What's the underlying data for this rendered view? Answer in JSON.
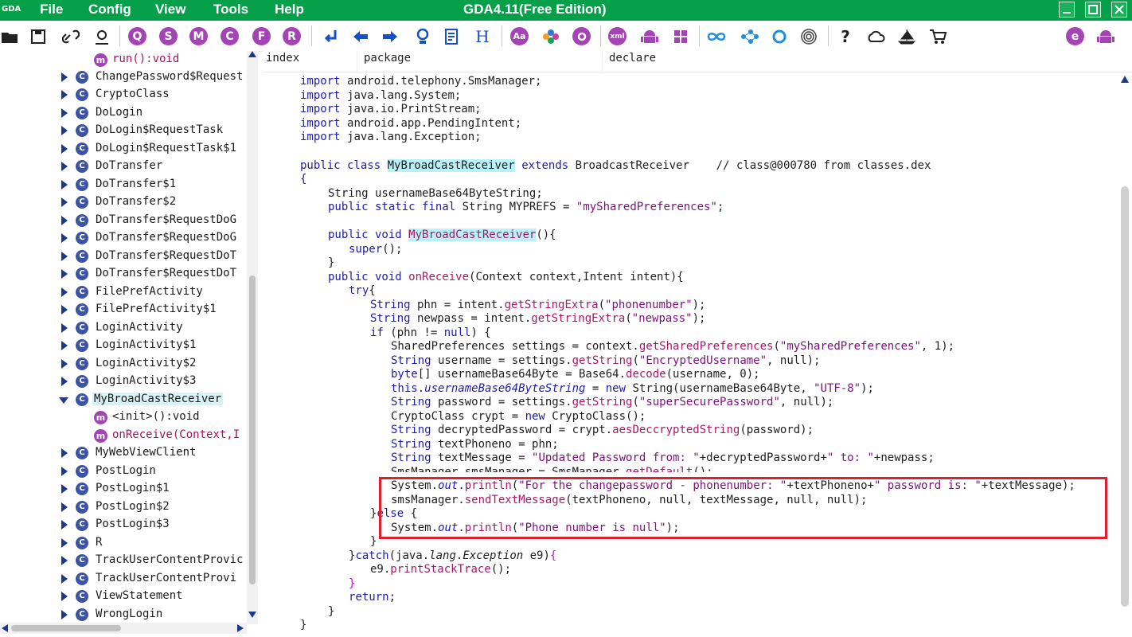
{
  "app": {
    "title": "GDA4.11(Free Edition)",
    "logo_text": "GDA",
    "menu": [
      "File",
      "Config",
      "View",
      "Tools",
      "Help"
    ]
  },
  "colors": {
    "titlebar": "#07a04a",
    "toolbar_circle": "#a444b4",
    "class_icon": "#3d53a3",
    "method_icon": "#a444b4",
    "highlight_box": "#e0202e"
  },
  "toolbar": {
    "icons": [
      "open-folder-icon",
      "save-icon",
      "link-icon",
      "user-refresh-icon",
      "search-q-icon",
      "string-s-icon",
      "method-m-icon",
      "class-c-icon",
      "field-f-icon",
      "resource-r-icon",
      "jump-back-icon",
      "arrow-left-icon",
      "arrow-right-icon",
      "bookmark-icon",
      "report-icon",
      "hex-h-icon",
      "font-aa-icon",
      "palette-icon",
      "settings-icon",
      "xml-icon",
      "android-icon",
      "windows-icon",
      "infinity-icon",
      "graph-icon",
      "ring-icon",
      "fingerprint-icon",
      "help-icon",
      "cloud-icon",
      "ship-icon",
      "cart-icon",
      "encrypt-e-icon",
      "android-small-icon"
    ],
    "letters": {
      "q": "Q",
      "s": "S",
      "m": "M",
      "c": "C",
      "f": "F",
      "r": "R",
      "h": "H",
      "aa": "Aa",
      "xml": "xml",
      "help": "?",
      "e": "e"
    }
  },
  "tree": {
    "items": [
      {
        "type": "method",
        "label": "run():void",
        "expanded": false
      },
      {
        "type": "class",
        "label": "ChangePassword$Request"
      },
      {
        "type": "class",
        "label": "CryptoClass"
      },
      {
        "type": "class",
        "label": "DoLogin"
      },
      {
        "type": "class",
        "label": "DoLogin$RequestTask"
      },
      {
        "type": "class",
        "label": "DoLogin$RequestTask$1"
      },
      {
        "type": "class",
        "label": "DoTransfer"
      },
      {
        "type": "class",
        "label": "DoTransfer$1"
      },
      {
        "type": "class",
        "label": "DoTransfer$2"
      },
      {
        "type": "class",
        "label": "DoTransfer$RequestDoG"
      },
      {
        "type": "class",
        "label": "DoTransfer$RequestDoG"
      },
      {
        "type": "class",
        "label": "DoTransfer$RequestDoT"
      },
      {
        "type": "class",
        "label": "DoTransfer$RequestDoT"
      },
      {
        "type": "class",
        "label": "FilePrefActivity"
      },
      {
        "type": "class",
        "label": "FilePrefActivity$1"
      },
      {
        "type": "class",
        "label": "LoginActivity"
      },
      {
        "type": "class",
        "label": "LoginActivity$1"
      },
      {
        "type": "class",
        "label": "LoginActivity$2"
      },
      {
        "type": "class",
        "label": "LoginActivity$3"
      },
      {
        "type": "class",
        "label": "MyBroadCastReceiver",
        "selected": true,
        "expanded": true
      },
      {
        "type": "method",
        "label": "<init>():void"
      },
      {
        "type": "method",
        "label": "onReceive(Context,I"
      },
      {
        "type": "class",
        "label": "MyWebViewClient"
      },
      {
        "type": "class",
        "label": "PostLogin"
      },
      {
        "type": "class",
        "label": "PostLogin$1"
      },
      {
        "type": "class",
        "label": "PostLogin$2"
      },
      {
        "type": "class",
        "label": "PostLogin$3"
      },
      {
        "type": "class",
        "label": "R"
      },
      {
        "type": "class",
        "label": "TrackUserContentProvic"
      },
      {
        "type": "class",
        "label": "TrackUserContentProvi"
      },
      {
        "type": "class",
        "label": "ViewStatement"
      },
      {
        "type": "class",
        "label": "WrongLogin"
      }
    ],
    "class_letter": "C",
    "method_letter": "m"
  },
  "table_header": {
    "index": "index",
    "package": "package",
    "declare": "declare"
  },
  "code": {
    "imports": [
      "android.telephony.SmsManager;",
      "java.lang.System;",
      "java.io.PrintStream;",
      "android.app.PendingIntent;",
      "java.lang.Exception;"
    ],
    "import_kw": "import",
    "class_name": "MyBroadCastReceiver",
    "super_name": "BroadcastReceiver",
    "class_comment": "// class@000780 from classes.dex",
    "field1": "String usernameBase64ByteString;",
    "field2_str": "\"mySharedPreferences\"",
    "field2_rest": "String MYPREFS = ",
    "l_phn_str": "\"phonenumber\"",
    "l_newpass_str": "\"newpass\"",
    "l_prefs_str": "\"mySharedPreferences\"",
    "l_user_str": "\"EncryptedUsername\"",
    "l_utf": "\"UTF-8\"",
    "l_pass_str": "\"superSecurePassword\"",
    "l_updated_str": "\"Updated Password from: \"",
    "l_to_str": "\" to: \"",
    "l_for_str": "\"For the changepassword - phonenumber: \"",
    "l_pw_str": "\" password is: \"",
    "l_null_str": "\"Phone number is null\""
  }
}
